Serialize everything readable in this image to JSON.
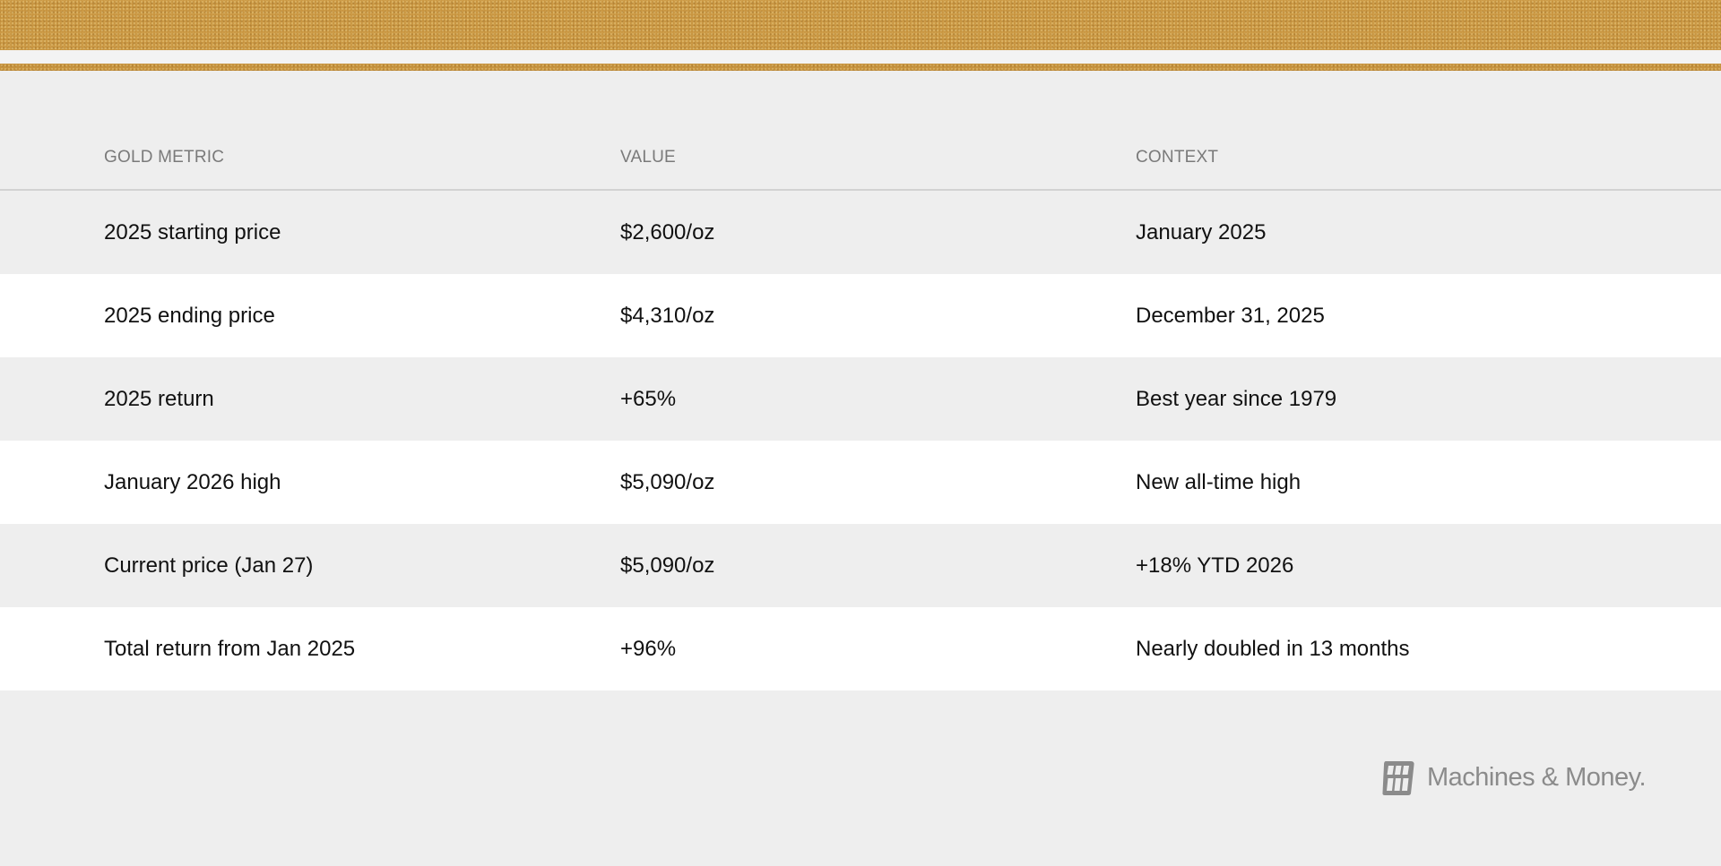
{
  "table": {
    "headers": [
      "GOLD METRIC",
      "VALUE",
      "CONTEXT"
    ],
    "rows": [
      {
        "metric": "2025 starting price",
        "value": "$2,600/oz",
        "context": "January 2025"
      },
      {
        "metric": "2025 ending price",
        "value": "$4,310/oz",
        "context": "December 31, 2025"
      },
      {
        "metric": "2025 return",
        "value": "+65%",
        "context": "Best year since 1979"
      },
      {
        "metric": "January 2026 high",
        "value": "$5,090/oz",
        "context": "New all-time high"
      },
      {
        "metric": "Current price (Jan 27)",
        "value": "$5,090/oz",
        "context": "+18% YTD 2026"
      },
      {
        "metric": "Total return from Jan 2025",
        "value": "+96%",
        "context": "Nearly doubled in 13 months"
      }
    ]
  },
  "brand": {
    "name": "Machines & Money.",
    "logo_icon": "machines-and-money-logo"
  },
  "colors": {
    "gold": "#c6923d",
    "background": "#eeeeee",
    "row_alt": "#ffffff",
    "header_text": "#7a7a7a",
    "brand_text": "#8b8b8b"
  }
}
